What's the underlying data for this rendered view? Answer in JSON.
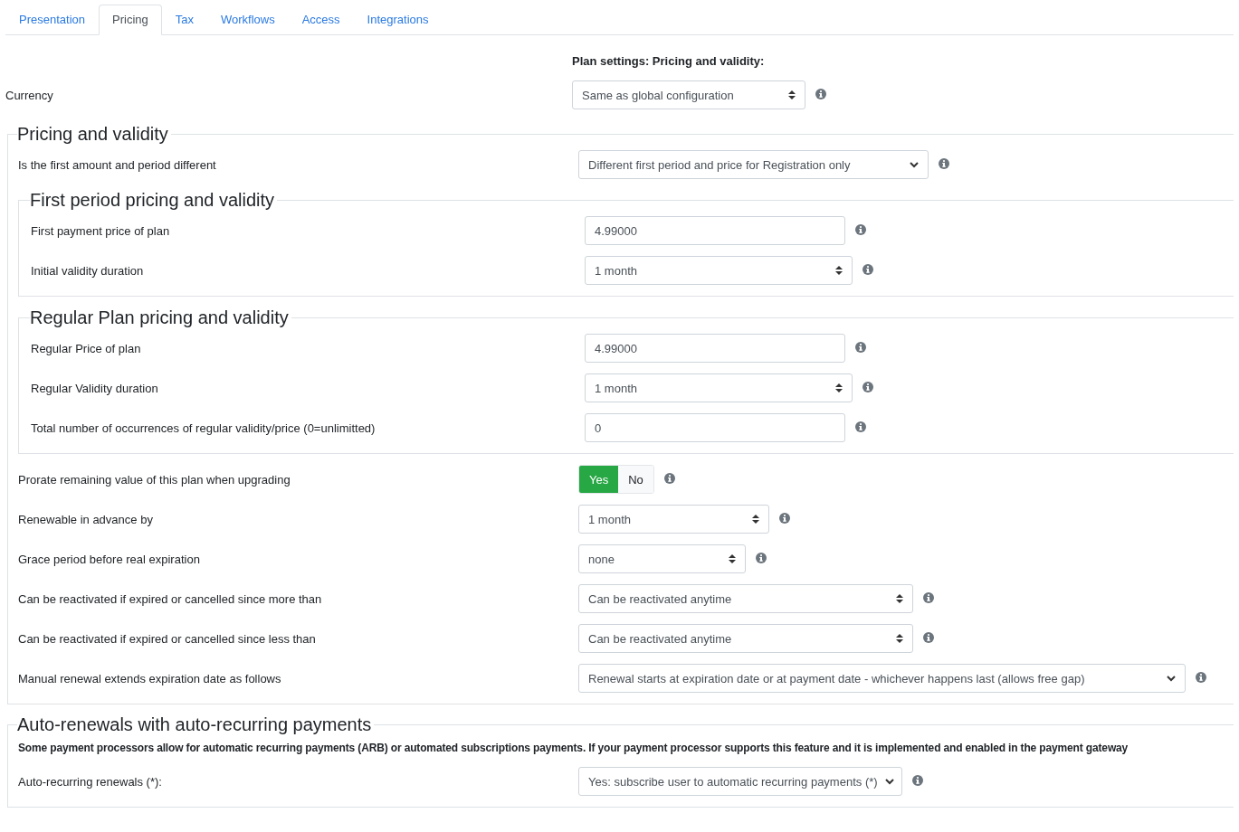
{
  "tabs": [
    {
      "label": "Presentation",
      "selected": false
    },
    {
      "label": "Pricing",
      "selected": true
    },
    {
      "label": "Tax",
      "selected": false
    },
    {
      "label": "Workflows",
      "selected": false
    },
    {
      "label": "Access",
      "selected": false
    },
    {
      "label": "Integrations",
      "selected": false
    }
  ],
  "heading": "Plan settings: Pricing and validity:",
  "currency": {
    "label": "Currency",
    "kind": "spin-select",
    "value": "Same as global configuration"
  },
  "sections": [
    {
      "legend": "Pricing and validity",
      "items": [
        {
          "kind": "select",
          "label": "Is the first amount and period different",
          "value": "Different first period and price for Registration only"
        },
        {
          "kind": "group",
          "legend": "First period pricing and validity",
          "rows": [
            {
              "kind": "input",
              "label": "First payment price of plan",
              "value": "4.99000"
            },
            {
              "kind": "spin-select",
              "label": "Initial validity duration",
              "value": "1 month"
            }
          ]
        },
        {
          "kind": "group",
          "legend": "Regular Plan pricing and validity",
          "rows": [
            {
              "kind": "input",
              "label": "Regular Price of plan",
              "value": "4.99000"
            },
            {
              "kind": "spin-select",
              "label": "Regular Validity duration",
              "value": "1 month"
            },
            {
              "kind": "input",
              "label": "Total number of occurrences of regular validity/price (0=unlimitted)",
              "value": "0"
            }
          ]
        },
        {
          "kind": "toggle",
          "label": "Prorate remaining value of this plan when upgrading",
          "options": [
            {
              "label": "Yes",
              "selected": true
            },
            {
              "label": "No",
              "selected": false
            }
          ]
        },
        {
          "kind": "spin-select",
          "label": "Renewable in advance by",
          "value": "1 month"
        },
        {
          "kind": "spin-select",
          "label": "Grace period before real expiration",
          "value": "none"
        },
        {
          "kind": "spin-select",
          "label": "Can be reactivated if expired or cancelled since more than",
          "value": "Can be reactivated anytime"
        },
        {
          "kind": "spin-select",
          "label": "Can be reactivated if expired or cancelled since less than",
          "value": "Can be reactivated anytime"
        },
        {
          "kind": "select",
          "label": "Manual renewal extends expiration date as follows",
          "value": "Renewal starts at expiration date or at payment date - whichever happens last (allows free gap)"
        }
      ]
    },
    {
      "legend": "Auto-renewals with auto-recurring payments",
      "note": "Some payment processors allow for automatic recurring payments (ARB) or automated subscriptions payments. If your payment processor supports this feature and it is implemented and enabled in the payment gateway",
      "items": [
        {
          "kind": "select",
          "label": "Auto-recurring renewals (*):",
          "value": "Yes: subscribe user to automatic recurring payments (*)"
        }
      ]
    }
  ]
}
